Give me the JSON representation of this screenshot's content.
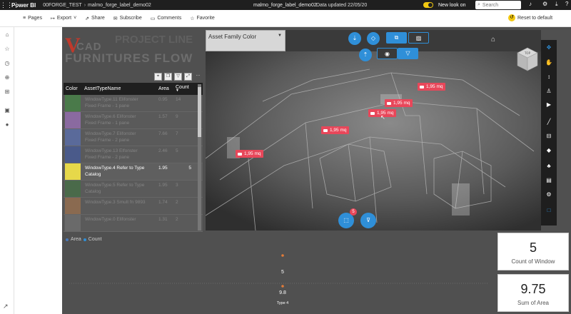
{
  "topbar": {
    "app": "Power BI",
    "workspace": "00FORGE_TEST",
    "report": "malmo_forge_label_demo02",
    "title": "malmo_forge_label_demo02",
    "updated": "Data updated 22/05/20",
    "new_look": "New look on",
    "search_placeholder": "Search"
  },
  "toolbar": {
    "pages": "Pages",
    "export": "Export",
    "share": "Share",
    "subscribe": "Subscribe",
    "comments": "Comments",
    "favorite": "Favorite",
    "reset": "Reset to default"
  },
  "logo": {
    "v": "V",
    "cad": "CAD",
    "ghost": "PROJECT LINE",
    "subtitle": "FURNITURES FLOW"
  },
  "table": {
    "headers": {
      "color": "Color",
      "name": "AssetTypeName",
      "area": "Area",
      "count": "Count"
    },
    "rows": [
      {
        "color": "#4a7a4a",
        "l1": "WindowType.11 Elifonster",
        "l2": "Fixed Frame - 1 pane",
        "area": "0.95",
        "count": "14",
        "selected": false
      },
      {
        "color": "#8a6aa0",
        "l1": "WindowType.6 Elifonster",
        "l2": "Fixed Frame - 1 pane",
        "area": "1.57",
        "count": "9",
        "selected": false
      },
      {
        "color": "#5a6a9a",
        "l1": "WindowType.7 Elifonster",
        "l2": "Fixed Frame - 2 pane",
        "area": "7.66",
        "count": "7",
        "selected": false
      },
      {
        "color": "#4a5a8a",
        "l1": "WindowType.13 Elfonster",
        "l2": "Fixed Frame - 2 pane",
        "area": "2.46",
        "count": "5",
        "selected": false
      },
      {
        "color": "#e6d84a",
        "l1": "WindowType.4 Refer to Type",
        "l2": "Catalog",
        "area": "1.95",
        "count": "5",
        "selected": true
      },
      {
        "color": "#4a6a4a",
        "l1": "WindowType.5 Refer to Type",
        "l2": "Catalog",
        "area": "1.95",
        "count": "3",
        "selected": false
      },
      {
        "color": "#8a6a50",
        "l1": "WindowType.3 Smult fn 9893",
        "l2": "",
        "area": "1.74",
        "count": "2",
        "selected": false
      },
      {
        "color": "#6a6a6a",
        "l1": "WindowType.0 Elifonster",
        "l2": "",
        "area": "1.31",
        "count": "2",
        "selected": false
      }
    ]
  },
  "dropdown": {
    "label": "Asset Family Color"
  },
  "viewer": {
    "labels": [
      {
        "text": "1,95 mq"
      },
      {
        "text": "1,95 mq"
      },
      {
        "text": "1,95 mq"
      },
      {
        "text": "1,95 mq"
      },
      {
        "text": "1,95 mq"
      }
    ],
    "badge_count": "5",
    "cube_label": "TOP"
  },
  "legend": {
    "area": "Area",
    "count": "Count"
  },
  "colors": {
    "area_dot": "#4a78b8",
    "count_dot": "#2f8fd8",
    "point": "#e07b39"
  },
  "chart_data": {
    "type": "line",
    "categories": [
      "Type 4"
    ],
    "series": [
      {
        "name": "Area",
        "values": [
          9.8
        ]
      },
      {
        "name": "Count",
        "values": [
          5
        ]
      }
    ],
    "data_labels": [
      "5",
      "9.8"
    ],
    "tick_label": "Type 4"
  },
  "cards": [
    {
      "value": "5",
      "caption": "Count of Window"
    },
    {
      "value": "9.75",
      "caption": "Sum of Area"
    }
  ]
}
